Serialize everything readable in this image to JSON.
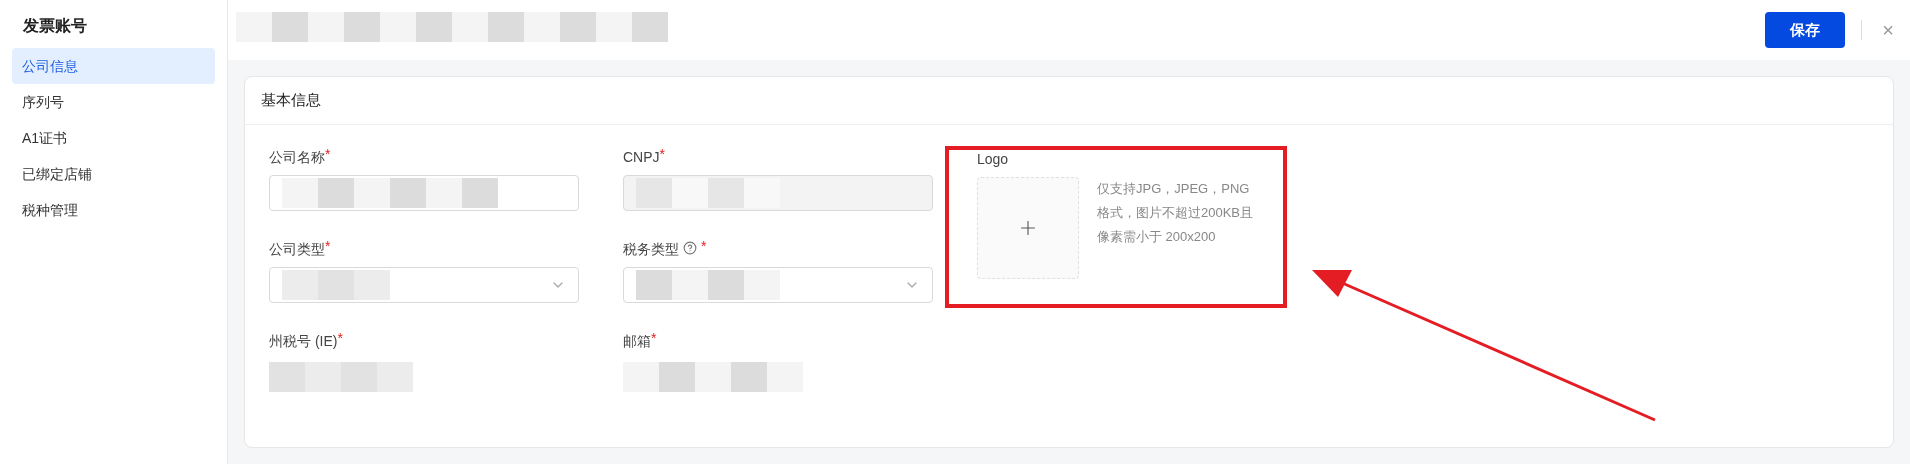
{
  "sidebar": {
    "title": "发票账号",
    "items": [
      {
        "label": "公司信息",
        "selected": true
      },
      {
        "label": "序列号",
        "selected": false
      },
      {
        "label": "A1证书",
        "selected": false
      },
      {
        "label": "已绑定店铺",
        "selected": false
      },
      {
        "label": "税种管理",
        "selected": false
      }
    ]
  },
  "header": {
    "save_button": "保存",
    "close": "×"
  },
  "card": {
    "title": "基本信息",
    "fields": [
      {
        "label": "公司名称",
        "required_mark": "*",
        "kind": "input"
      },
      {
        "label": "CNPJ",
        "required_mark": "*",
        "kind": "input",
        "disabled": true
      },
      {
        "label": "公司类型",
        "required_mark": "*",
        "kind": "select"
      },
      {
        "label": "税务类型",
        "required_mark": "*",
        "kind": "select",
        "help": true
      },
      {
        "label": "州税号 (IE)",
        "required_mark": "*",
        "kind": "plain"
      },
      {
        "label": "邮箱",
        "required_mark": "*",
        "kind": "plain"
      }
    ],
    "logo": {
      "label": "Logo",
      "hint": "仅支持JPG，JPEG，PNG格式，图片不超过200KB且像素需小于 200x200"
    }
  }
}
